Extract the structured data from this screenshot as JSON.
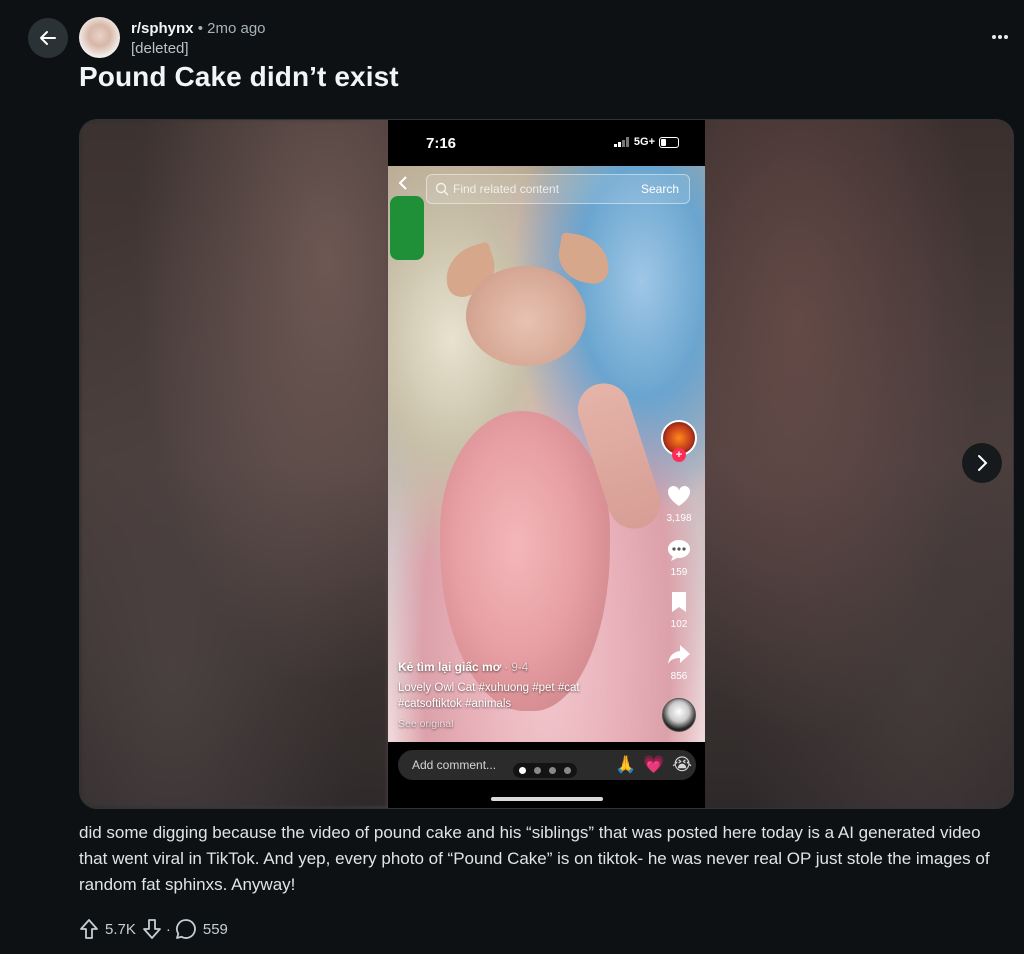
{
  "post": {
    "subreddit": "r/sphynx",
    "separator": "•",
    "time": "2mo ago",
    "author": "[deleted]",
    "title": "Pound Cake didn’t exist",
    "body": "did some digging because the video of pound cake and his “siblings” that was posted here today is a AI generated video that went viral in TikTok. And yep, every photo of “Pound Cake” is on tiktok- he was never real OP just stole the images of random fat sphinxs. Anyway!",
    "upvotes": "5.7K",
    "comments": "559",
    "dot": "·"
  },
  "screenshot": {
    "clock": "7:16",
    "network": "5G+",
    "search_placeholder": "Find related content",
    "search_button": "Search",
    "likes": "3,198",
    "comments": "159",
    "saves": "102",
    "shares": "856",
    "caption_name": "Kẻ tìm lại giấc mơ",
    "caption_date": "· 9-4",
    "caption_text": "Lovely Owl Cat #xuhuong #pet #cat #catsoftiktok #animals",
    "see_original": "See original",
    "comment_placeholder": "Add comment...",
    "emojis": [
      "🙏",
      "💗",
      "😭"
    ],
    "gallery_index": 1,
    "gallery_total": 4
  },
  "icons": {
    "back": "arrow-left-icon",
    "more": "more-horizontal-icon",
    "next": "chevron-right-icon",
    "upvote": "arrow-up-icon",
    "downvote": "arrow-down-icon",
    "comment": "comment-bubble-icon"
  },
  "colors": {
    "background": "#0e1113",
    "text": "#f2f4f5",
    "muted": "#a8b3b9"
  }
}
